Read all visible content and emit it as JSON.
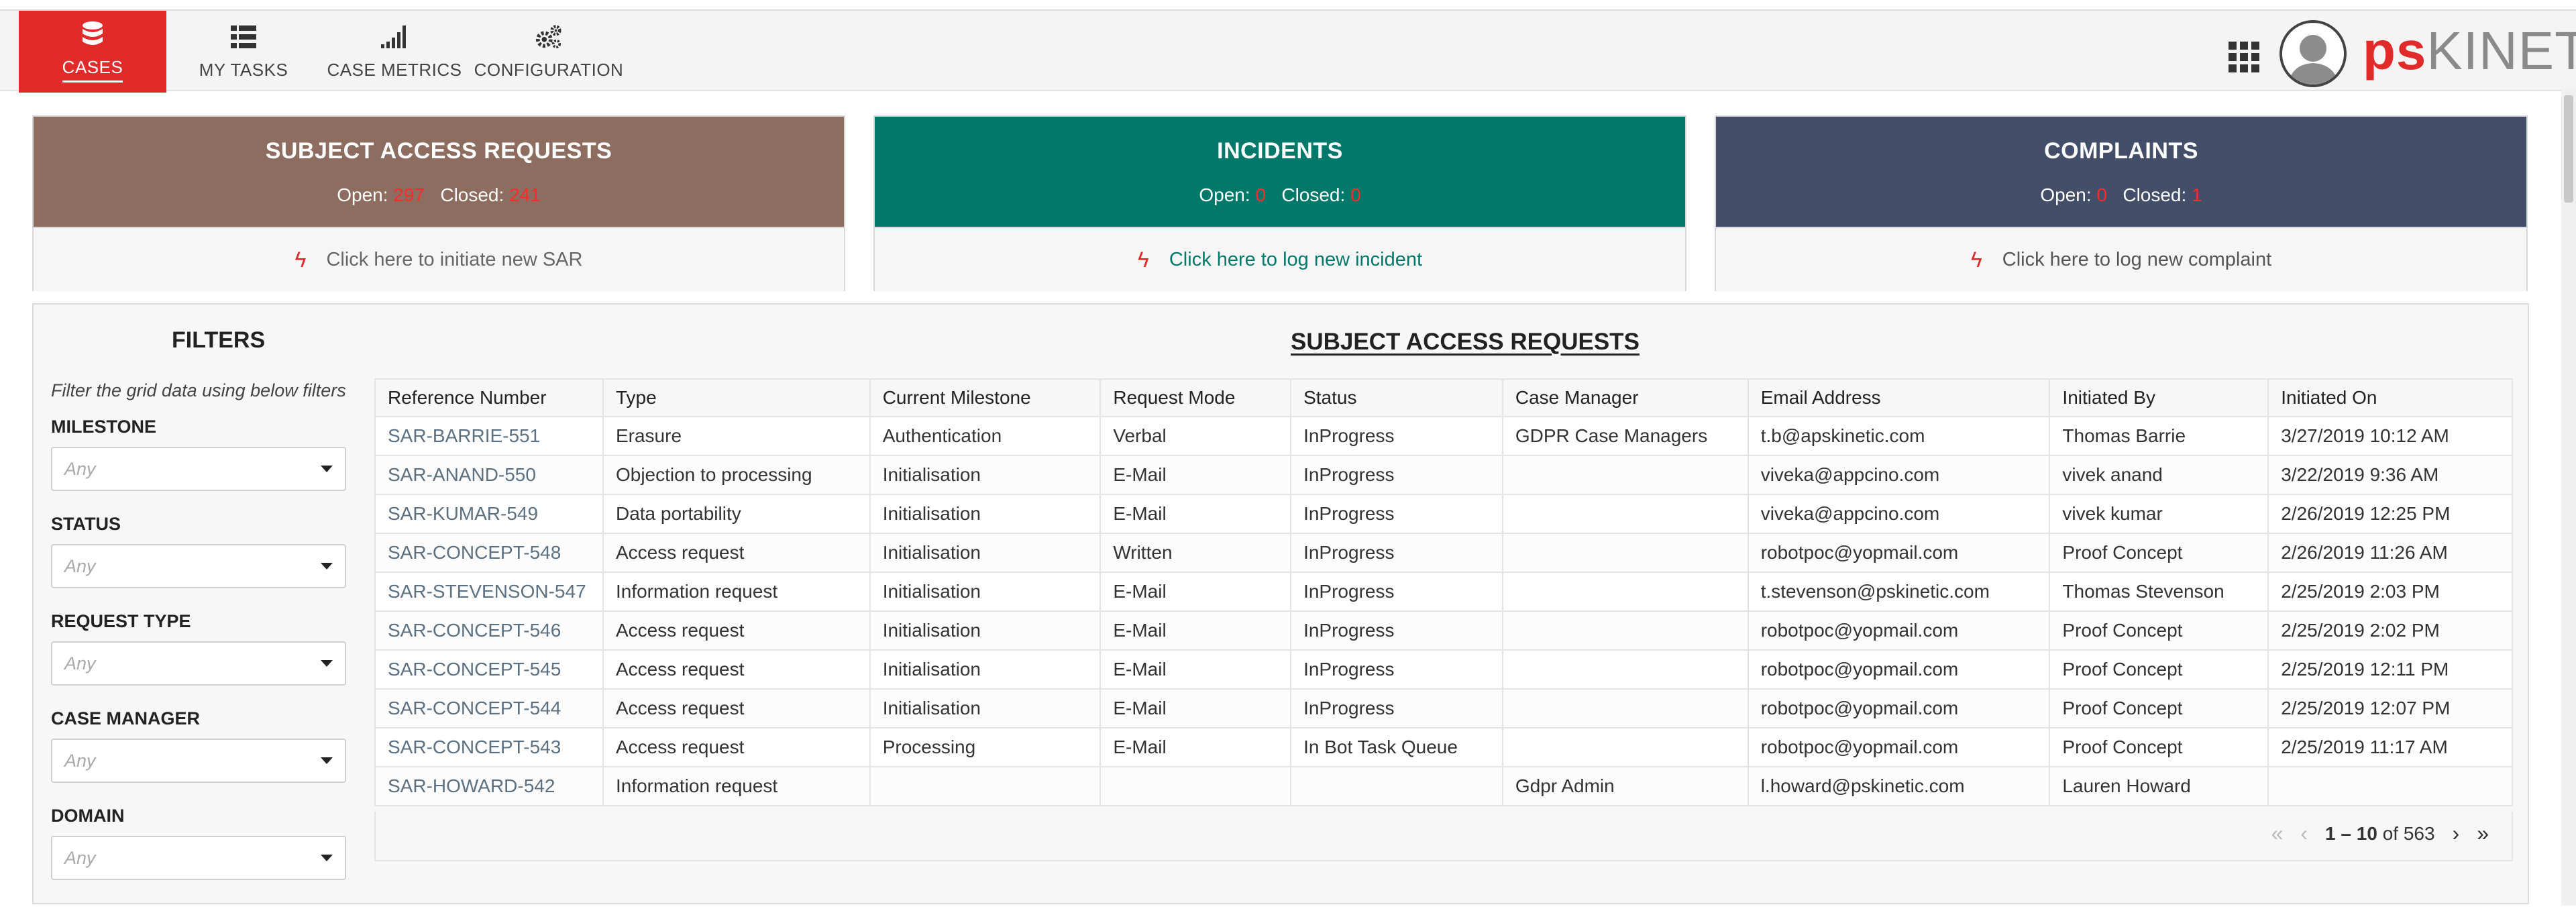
{
  "nav": {
    "items": [
      {
        "label": "CASES",
        "icon": "database-icon",
        "active": true
      },
      {
        "label": "MY TASKS",
        "icon": "list-icon"
      },
      {
        "label": "CASE METRICS",
        "icon": "signal-bars-icon"
      },
      {
        "label": "CONFIGURATION",
        "icon": "cogs-icon"
      }
    ]
  },
  "brand": {
    "ps": "ps",
    "kinetic": "KINETIC",
    "accent": "#e12b2b"
  },
  "cards": [
    {
      "title": "SUBJECT ACCESS REQUESTS",
      "open_label": "Open:",
      "open": "297",
      "closed_label": "Closed:",
      "closed": "241",
      "action": "Click here to initiate new SAR",
      "color": "#8c6d60"
    },
    {
      "title": "INCIDENTS",
      "open_label": "Open:",
      "open": "0",
      "closed_label": "Closed:",
      "closed": "0",
      "action": "Click here to log new incident",
      "color": "#00796b"
    },
    {
      "title": "COMPLAINTS",
      "open_label": "Open:",
      "open": "0",
      "closed_label": "Closed:",
      "closed": "1",
      "action": "Click here to log new complaint",
      "color": "#434f68"
    }
  ],
  "filters": {
    "title": "FILTERS",
    "hint": "Filter the grid data using below filters",
    "fields": [
      {
        "label": "MILESTONE",
        "placeholder": "Any"
      },
      {
        "label": "STATUS",
        "placeholder": "Any"
      },
      {
        "label": "REQUEST TYPE",
        "placeholder": "Any"
      },
      {
        "label": "CASE MANAGER",
        "placeholder": "Any"
      },
      {
        "label": "DOMAIN",
        "placeholder": "Any"
      }
    ]
  },
  "grid": {
    "title": "SUBJECT ACCESS REQUESTS",
    "columns": [
      "Reference Number",
      "Type",
      "Current Milestone",
      "Request Mode",
      "Status",
      "Case Manager",
      "Email Address",
      "Initiated By",
      "Initiated On"
    ],
    "rows": [
      [
        "SAR-BARRIE-551",
        "Erasure",
        "Authentication",
        "Verbal",
        "InProgress",
        "GDPR Case Managers",
        "t.b@apskinetic.com",
        "Thomas Barrie",
        "3/27/2019 10:12 AM"
      ],
      [
        "SAR-ANAND-550",
        "Objection to processing",
        "Initialisation",
        "E-Mail",
        "InProgress",
        "",
        "viveka@appcino.com",
        "vivek anand",
        "3/22/2019 9:36 AM"
      ],
      [
        "SAR-KUMAR-549",
        "Data portability",
        "Initialisation",
        "E-Mail",
        "InProgress",
        "",
        "viveka@appcino.com",
        "vivek kumar",
        "2/26/2019 12:25 PM"
      ],
      [
        "SAR-CONCEPT-548",
        "Access request",
        "Initialisation",
        "Written",
        "InProgress",
        "",
        "robotpoc@yopmail.com",
        "Proof Concept",
        "2/26/2019 11:26 AM"
      ],
      [
        "SAR-STEVENSON-547",
        "Information request",
        "Initialisation",
        "E-Mail",
        "InProgress",
        "",
        "t.stevenson@pskinetic.com",
        "Thomas Stevenson",
        "2/25/2019 2:03 PM"
      ],
      [
        "SAR-CONCEPT-546",
        "Access request",
        "Initialisation",
        "E-Mail",
        "InProgress",
        "",
        "robotpoc@yopmail.com",
        "Proof Concept",
        "2/25/2019 2:02 PM"
      ],
      [
        "SAR-CONCEPT-545",
        "Access request",
        "Initialisation",
        "E-Mail",
        "InProgress",
        "",
        "robotpoc@yopmail.com",
        "Proof Concept",
        "2/25/2019 12:11 PM"
      ],
      [
        "SAR-CONCEPT-544",
        "Access request",
        "Initialisation",
        "E-Mail",
        "InProgress",
        "",
        "robotpoc@yopmail.com",
        "Proof Concept",
        "2/25/2019 12:07 PM"
      ],
      [
        "SAR-CONCEPT-543",
        "Access request",
        "Processing",
        "E-Mail",
        "In Bot Task Queue",
        "",
        "robotpoc@yopmail.com",
        "Proof Concept",
        "2/25/2019 11:17 AM"
      ],
      [
        "SAR-HOWARD-542",
        "Information request",
        "",
        "",
        "",
        "Gdpr Admin",
        "l.howard@pskinetic.com",
        "Lauren Howard",
        ""
      ]
    ]
  },
  "pager": {
    "range": "1 – 10",
    "of": "of 563"
  }
}
